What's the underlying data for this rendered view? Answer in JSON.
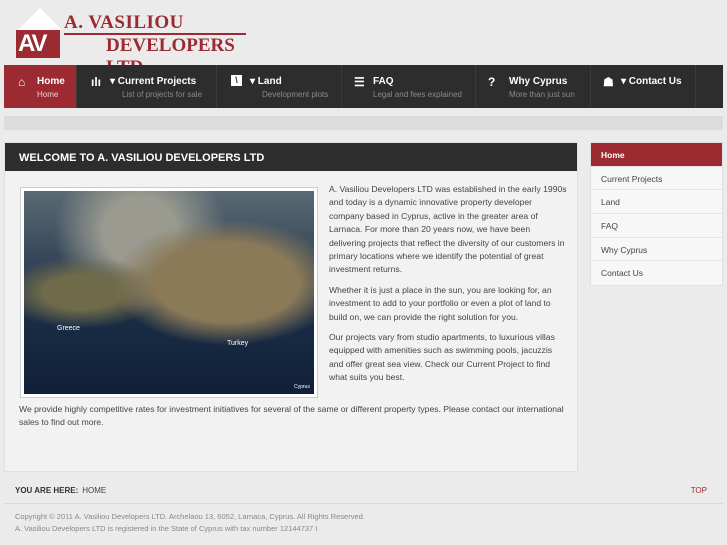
{
  "logo": {
    "initials": "AV",
    "line1": "A. VASILIOU",
    "line2": "DEVELOPERS LTD"
  },
  "nav": [
    {
      "label": "Home",
      "sub": "Home",
      "icon": "home-icon"
    },
    {
      "label": "▾ Current Projects",
      "sub": "List of projects for sale",
      "icon": "chart-icon"
    },
    {
      "label": "▾ Land",
      "sub": "Development plots",
      "icon": "land-icon"
    },
    {
      "label": "FAQ",
      "sub": "Legal and fees explained",
      "icon": "list-icon"
    },
    {
      "label": "Why Cyprus",
      "sub": "More than just sun",
      "icon": "question-icon"
    },
    {
      "label": "▾ Contact Us",
      "sub": "",
      "icon": "people-icon"
    }
  ],
  "main": {
    "title": "WELCOME TO A. VASILIOU DEVELOPERS LTD",
    "map_labels": {
      "greece": "Greece",
      "turkey": "Turkey",
      "cyprus": "Cyprus"
    },
    "paragraphs": [
      "A. Vasiliou Developers LTD was established in the early 1990s and today is a dynamic innovative property developer company based in Cyprus, active in the greater area of Larnaca. For more than 20 years now, we have been delivering projects that reflect the diversity of our customers in primary locations where we identify the potential of great investment returns.",
      "Whether it is just a place in the sun, you are looking for, an investment to add to your portfolio or even a plot of land to build on, we can provide the right solution for you.",
      "Our projects vary from studio apartments, to luxurious villas equipped with amenities such as swimming pools, jacuzzis and offer great sea view. Check our Current Project to find what suits you best."
    ],
    "wide": "We provide highly competitive rates for investment initiatives for several of the same or different property types. Please contact our international sales to find out more."
  },
  "sidebar": [
    "Home",
    "Current Projects",
    "Land",
    "FAQ",
    "Why Cyprus",
    "Contact Us"
  ],
  "breadcrumb": {
    "label": "YOU ARE HERE:",
    "current": "HOME"
  },
  "top": "TOP",
  "footer": {
    "line1": "Copyright © 2011 A. Vasiliou Developers LTD. Archelaou 13, 6052, Larnaca, Cyprus. All Rights Reserved.",
    "line2": "A. Vasiliou Developers LTD is registered in the State of Cyprus with tax number 12144737 I"
  }
}
